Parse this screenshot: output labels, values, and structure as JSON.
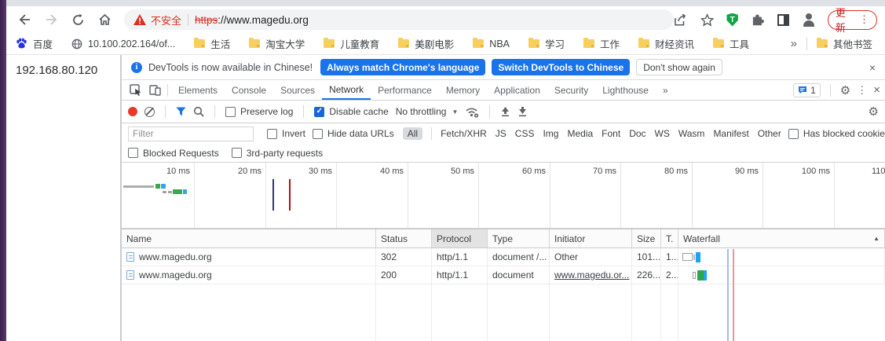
{
  "colors": {
    "accent_blue": "#1a73e8",
    "danger_red": "#d93025",
    "record_red": "#e8382a",
    "shield_green": "#12a347",
    "folder_yellow": "#f6cf5d",
    "waterfall_green": "#2ca54d",
    "waterfall_blue": "#1fa3ef",
    "event_dcl_blue": "#32327f",
    "event_load_red": "#b40e0e"
  },
  "browser": {
    "security_label": "不安全",
    "url_scheme": "https",
    "url_rest": "://www.magedu.org",
    "update_label": "更新",
    "bookmarks": [
      {
        "label": "百度"
      },
      {
        "label": "10.100.202.164/of..."
      },
      {
        "label": "生活"
      },
      {
        "label": "淘宝大学"
      },
      {
        "label": "儿童教育"
      },
      {
        "label": "美剧电影"
      },
      {
        "label": "NBA"
      },
      {
        "label": "学习"
      },
      {
        "label": "工作"
      },
      {
        "label": "财经资讯"
      },
      {
        "label": "工具"
      }
    ],
    "other_bookmarks_label": "其他书签"
  },
  "page": {
    "text": "192.168.80.120"
  },
  "devtools": {
    "notification": {
      "message": "DevTools is now available in Chinese!",
      "primary_button": "Always match Chrome's language",
      "secondary_button": "Switch DevTools to Chinese",
      "dismiss_button": "Don't show again"
    },
    "tabs": [
      {
        "label": "Elements"
      },
      {
        "label": "Console"
      },
      {
        "label": "Sources"
      },
      {
        "label": "Network"
      },
      {
        "label": "Performance"
      },
      {
        "label": "Memory"
      },
      {
        "label": "Application"
      },
      {
        "label": "Security"
      },
      {
        "label": "Lighthouse"
      }
    ],
    "issues_count": "1",
    "toolbar": {
      "preserve_log": "Preserve log",
      "disable_cache": "Disable cache",
      "throttling": "No throttling"
    },
    "filters": {
      "placeholder": "Filter",
      "invert": "Invert",
      "hide_data_urls": "Hide data URLs",
      "types": [
        {
          "label": "All"
        },
        {
          "label": "Fetch/XHR"
        },
        {
          "label": "JS"
        },
        {
          "label": "CSS"
        },
        {
          "label": "Img"
        },
        {
          "label": "Media"
        },
        {
          "label": "Font"
        },
        {
          "label": "Doc"
        },
        {
          "label": "WS"
        },
        {
          "label": "Wasm"
        },
        {
          "label": "Manifest"
        },
        {
          "label": "Other"
        }
      ],
      "has_blocked_cookies": "Has blocked cookies",
      "blocked_requests": "Blocked Requests",
      "third_party": "3rd-party requests"
    },
    "timeline": {
      "ticks": [
        {
          "label": "10 ms"
        },
        {
          "label": "20 ms"
        },
        {
          "label": "30 ms"
        },
        {
          "label": "40 ms"
        },
        {
          "label": "50 ms"
        },
        {
          "label": "60 ms"
        },
        {
          "label": "70 ms"
        },
        {
          "label": "80 ms"
        },
        {
          "label": "90 ms"
        },
        {
          "label": "100 ms"
        },
        {
          "label": "110"
        }
      ]
    },
    "table": {
      "columns": [
        {
          "label": "Name"
        },
        {
          "label": "Status"
        },
        {
          "label": "Protocol"
        },
        {
          "label": "Type"
        },
        {
          "label": "Initiator"
        },
        {
          "label": "Size"
        },
        {
          "label": "T."
        },
        {
          "label": "Waterfall"
        }
      ],
      "rows": [
        {
          "name": "www.magedu.org",
          "status": "302",
          "protocol": "http/1.1",
          "type": "document /...",
          "initiator": "Other",
          "size": "101...",
          "time": "1..."
        },
        {
          "name": "www.magedu.org",
          "status": "200",
          "protocol": "http/1.1",
          "type": "document",
          "initiator": "www.magedu.or...",
          "size": "226...",
          "time": "2..."
        }
      ]
    }
  },
  "icons": {
    "more_chevron": "»",
    "close": "×",
    "overflow_dots": "⋮",
    "gear": "⚙",
    "check": "✓",
    "sort_asc": "▲",
    "dropdown_caret": "▼",
    "info_i": "i",
    "shield_letter": "T",
    "issues_one": "1"
  }
}
